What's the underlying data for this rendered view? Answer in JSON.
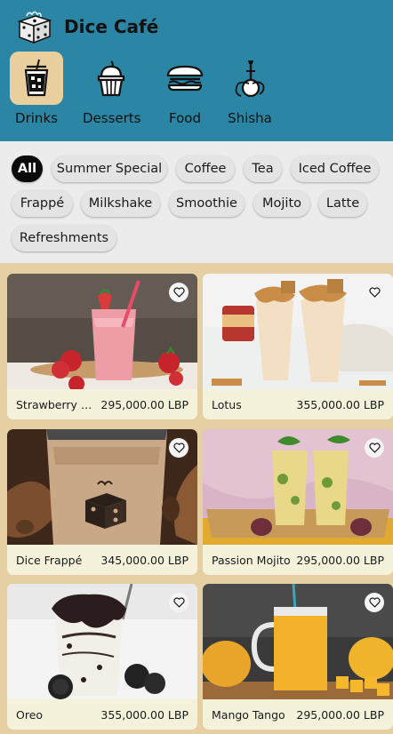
{
  "app": {
    "title": "Dice Café"
  },
  "categories": [
    {
      "label": "Drinks",
      "icon": "drink-cup-icon",
      "active": true
    },
    {
      "label": "Desserts",
      "icon": "cupcake-icon",
      "active": false
    },
    {
      "label": "Food",
      "icon": "burger-icon",
      "active": false
    },
    {
      "label": "Shisha",
      "icon": "hookah-icon",
      "active": false
    }
  ],
  "filters": [
    {
      "label": "All",
      "active": true
    },
    {
      "label": "Summer Special"
    },
    {
      "label": "Coffee"
    },
    {
      "label": "Tea"
    },
    {
      "label": "Iced Coffee"
    },
    {
      "label": "Frappé"
    },
    {
      "label": "Milkshake"
    },
    {
      "label": "Smoothie"
    },
    {
      "label": "Mojito"
    },
    {
      "label": "Latte"
    },
    {
      "label": "Refreshments"
    }
  ],
  "products": [
    {
      "name": "Strawberry Smoothie",
      "name_display": "Strawberry S...",
      "price": "295,000.00 LBP"
    },
    {
      "name": "Lotus",
      "price": "355,000.00 LBP"
    },
    {
      "name": "Dice Frappé",
      "price": "345,000.00 LBP"
    },
    {
      "name": "Passion Mojito",
      "price": "295,000.00 LBP"
    },
    {
      "name": "Oreo",
      "price": "355,000.00 LBP"
    },
    {
      "name": "Mango Tango",
      "price": "295,000.00 LBP"
    }
  ],
  "colors": {
    "header_bg": "#2a86a4",
    "active_category_bg": "#e9cf9d",
    "filters_bg": "#ececec",
    "grid_bg": "#e6cfa3",
    "card_footer_bg": "#f5f2dc"
  }
}
